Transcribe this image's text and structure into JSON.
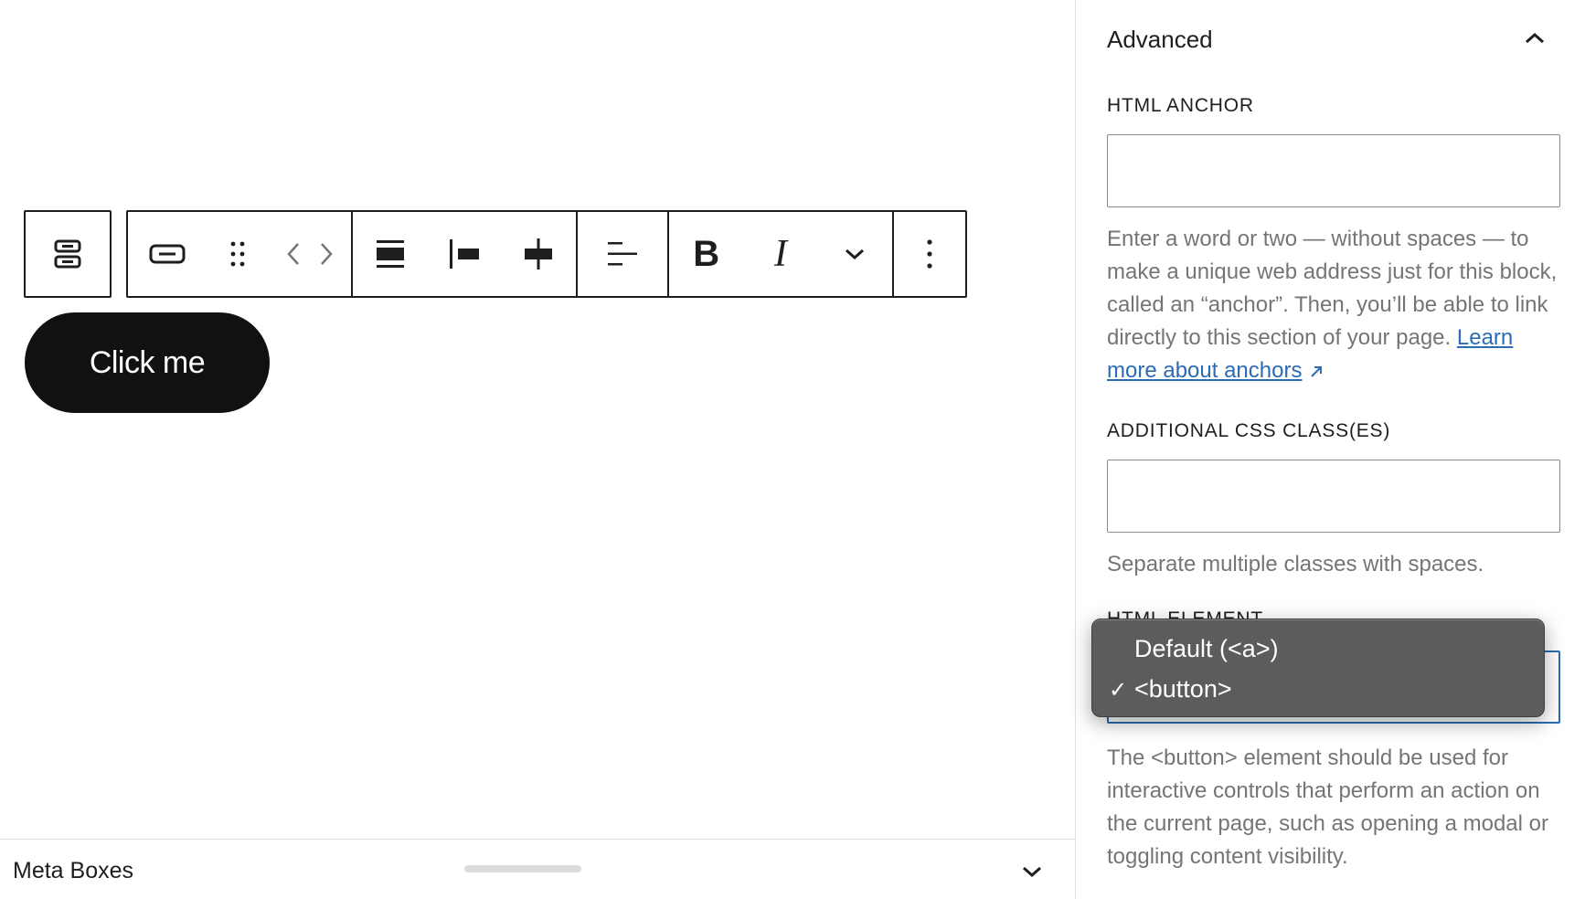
{
  "button_block": {
    "text": "Click me"
  },
  "meta_boxes": {
    "title": "Meta Boxes"
  },
  "sidebar": {
    "panel_title": "Advanced",
    "html_anchor": {
      "label": "HTML ANCHOR",
      "value": "",
      "help_text": "Enter a word or two — without spaces — to make a unique web address just for this block, called an “anchor”. Then, you’ll be able to link directly to this section of your page.",
      "link_text": "Learn more about anchors"
    },
    "css_classes": {
      "label": "ADDITIONAL CSS CLASS(ES)",
      "value": "",
      "help_text": "Separate multiple classes with spaces."
    },
    "html_element": {
      "label": "HTML ELEMENT",
      "selected": "<button>",
      "options": [
        {
          "label": "Default (<a>)",
          "checked": false
        },
        {
          "label": "<button>",
          "checked": true
        }
      ],
      "help_text": "The <button> element should be used for interactive controls that perform an action on the current page, such as opening a modal or toggling content visibility."
    }
  },
  "colors": {
    "accent": "#2a6bb4",
    "button_bg": "#111111",
    "help_text": "#757575",
    "dropdown_bg": "#5c5c5c"
  }
}
